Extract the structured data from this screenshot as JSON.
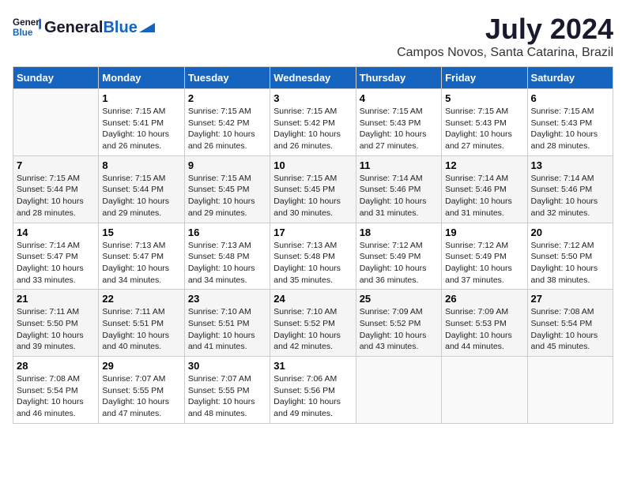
{
  "header": {
    "logo_general": "General",
    "logo_blue": "Blue",
    "month_year": "July 2024",
    "location": "Campos Novos, Santa Catarina, Brazil"
  },
  "days_of_week": [
    "Sunday",
    "Monday",
    "Tuesday",
    "Wednesday",
    "Thursday",
    "Friday",
    "Saturday"
  ],
  "weeks": [
    [
      {
        "day": "",
        "info": ""
      },
      {
        "day": "1",
        "info": "Sunrise: 7:15 AM\nSunset: 5:41 PM\nDaylight: 10 hours\nand 26 minutes."
      },
      {
        "day": "2",
        "info": "Sunrise: 7:15 AM\nSunset: 5:42 PM\nDaylight: 10 hours\nand 26 minutes."
      },
      {
        "day": "3",
        "info": "Sunrise: 7:15 AM\nSunset: 5:42 PM\nDaylight: 10 hours\nand 26 minutes."
      },
      {
        "day": "4",
        "info": "Sunrise: 7:15 AM\nSunset: 5:43 PM\nDaylight: 10 hours\nand 27 minutes."
      },
      {
        "day": "5",
        "info": "Sunrise: 7:15 AM\nSunset: 5:43 PM\nDaylight: 10 hours\nand 27 minutes."
      },
      {
        "day": "6",
        "info": "Sunrise: 7:15 AM\nSunset: 5:43 PM\nDaylight: 10 hours\nand 28 minutes."
      }
    ],
    [
      {
        "day": "7",
        "info": "Sunrise: 7:15 AM\nSunset: 5:44 PM\nDaylight: 10 hours\nand 28 minutes."
      },
      {
        "day": "8",
        "info": "Sunrise: 7:15 AM\nSunset: 5:44 PM\nDaylight: 10 hours\nand 29 minutes."
      },
      {
        "day": "9",
        "info": "Sunrise: 7:15 AM\nSunset: 5:45 PM\nDaylight: 10 hours\nand 29 minutes."
      },
      {
        "day": "10",
        "info": "Sunrise: 7:15 AM\nSunset: 5:45 PM\nDaylight: 10 hours\nand 30 minutes."
      },
      {
        "day": "11",
        "info": "Sunrise: 7:14 AM\nSunset: 5:46 PM\nDaylight: 10 hours\nand 31 minutes."
      },
      {
        "day": "12",
        "info": "Sunrise: 7:14 AM\nSunset: 5:46 PM\nDaylight: 10 hours\nand 31 minutes."
      },
      {
        "day": "13",
        "info": "Sunrise: 7:14 AM\nSunset: 5:46 PM\nDaylight: 10 hours\nand 32 minutes."
      }
    ],
    [
      {
        "day": "14",
        "info": "Sunrise: 7:14 AM\nSunset: 5:47 PM\nDaylight: 10 hours\nand 33 minutes."
      },
      {
        "day": "15",
        "info": "Sunrise: 7:13 AM\nSunset: 5:47 PM\nDaylight: 10 hours\nand 34 minutes."
      },
      {
        "day": "16",
        "info": "Sunrise: 7:13 AM\nSunset: 5:48 PM\nDaylight: 10 hours\nand 34 minutes."
      },
      {
        "day": "17",
        "info": "Sunrise: 7:13 AM\nSunset: 5:48 PM\nDaylight: 10 hours\nand 35 minutes."
      },
      {
        "day": "18",
        "info": "Sunrise: 7:12 AM\nSunset: 5:49 PM\nDaylight: 10 hours\nand 36 minutes."
      },
      {
        "day": "19",
        "info": "Sunrise: 7:12 AM\nSunset: 5:49 PM\nDaylight: 10 hours\nand 37 minutes."
      },
      {
        "day": "20",
        "info": "Sunrise: 7:12 AM\nSunset: 5:50 PM\nDaylight: 10 hours\nand 38 minutes."
      }
    ],
    [
      {
        "day": "21",
        "info": "Sunrise: 7:11 AM\nSunset: 5:50 PM\nDaylight: 10 hours\nand 39 minutes."
      },
      {
        "day": "22",
        "info": "Sunrise: 7:11 AM\nSunset: 5:51 PM\nDaylight: 10 hours\nand 40 minutes."
      },
      {
        "day": "23",
        "info": "Sunrise: 7:10 AM\nSunset: 5:51 PM\nDaylight: 10 hours\nand 41 minutes."
      },
      {
        "day": "24",
        "info": "Sunrise: 7:10 AM\nSunset: 5:52 PM\nDaylight: 10 hours\nand 42 minutes."
      },
      {
        "day": "25",
        "info": "Sunrise: 7:09 AM\nSunset: 5:52 PM\nDaylight: 10 hours\nand 43 minutes."
      },
      {
        "day": "26",
        "info": "Sunrise: 7:09 AM\nSunset: 5:53 PM\nDaylight: 10 hours\nand 44 minutes."
      },
      {
        "day": "27",
        "info": "Sunrise: 7:08 AM\nSunset: 5:54 PM\nDaylight: 10 hours\nand 45 minutes."
      }
    ],
    [
      {
        "day": "28",
        "info": "Sunrise: 7:08 AM\nSunset: 5:54 PM\nDaylight: 10 hours\nand 46 minutes."
      },
      {
        "day": "29",
        "info": "Sunrise: 7:07 AM\nSunset: 5:55 PM\nDaylight: 10 hours\nand 47 minutes."
      },
      {
        "day": "30",
        "info": "Sunrise: 7:07 AM\nSunset: 5:55 PM\nDaylight: 10 hours\nand 48 minutes."
      },
      {
        "day": "31",
        "info": "Sunrise: 7:06 AM\nSunset: 5:56 PM\nDaylight: 10 hours\nand 49 minutes."
      },
      {
        "day": "",
        "info": ""
      },
      {
        "day": "",
        "info": ""
      },
      {
        "day": "",
        "info": ""
      }
    ]
  ]
}
